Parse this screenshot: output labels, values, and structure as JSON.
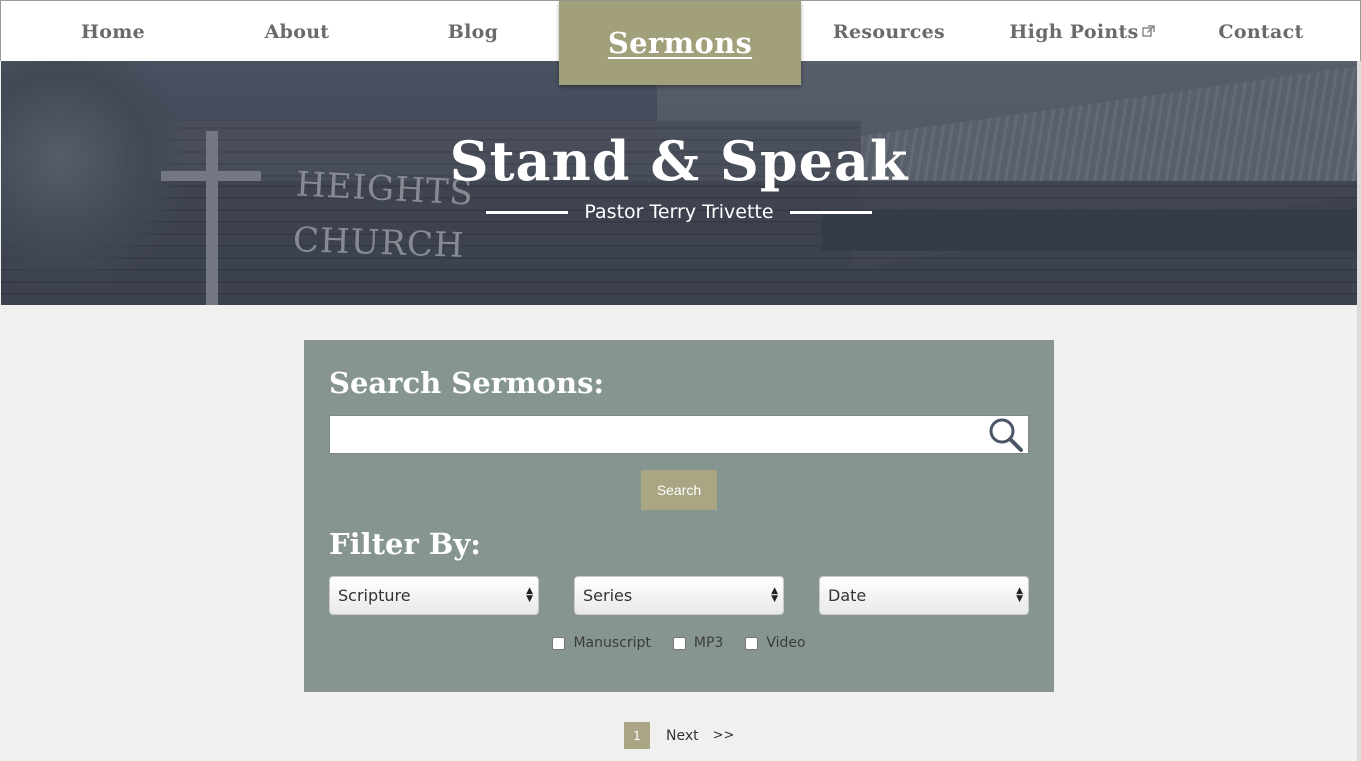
{
  "nav": {
    "items": [
      {
        "label": "Home"
      },
      {
        "label": "About"
      },
      {
        "label": "Blog"
      },
      {
        "label": "Sermons",
        "active": true
      },
      {
        "label": "Resources"
      },
      {
        "label": "High Points",
        "external": true
      },
      {
        "label": "Contact"
      }
    ]
  },
  "hero": {
    "title": "Stand & Speak",
    "subtitle": "Pastor Terry Trivette",
    "sign_line1": "HEIGHTS",
    "sign_line2": "CHURCH"
  },
  "search": {
    "heading": "Search Sermons:",
    "input_value": "",
    "button_label": "Search"
  },
  "filter": {
    "heading": "Filter By:",
    "selects": [
      {
        "value": "Scripture"
      },
      {
        "value": "Series"
      },
      {
        "value": "Date"
      }
    ],
    "checkboxes": [
      {
        "label": "Manuscript",
        "checked": false
      },
      {
        "label": "MP3",
        "checked": false
      },
      {
        "label": "Video",
        "checked": false
      }
    ]
  },
  "pagination": {
    "current_page": "1",
    "next_label": "Next",
    "last_label": ">>"
  },
  "colors": {
    "accent": "#a29f7b",
    "panel": "#879592",
    "nav_text": "#6a6a6a"
  }
}
